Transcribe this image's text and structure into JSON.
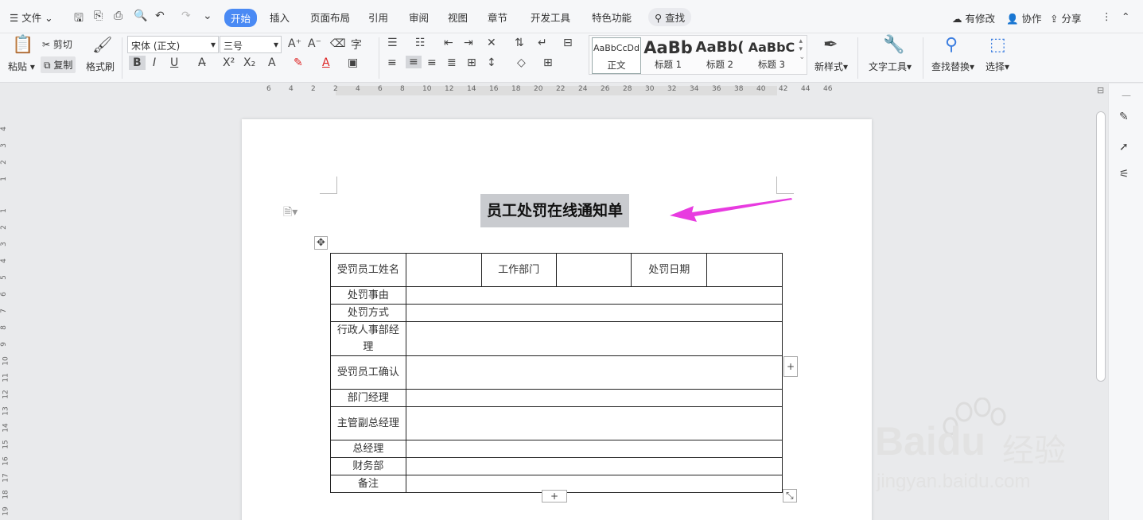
{
  "menubar": {
    "file": "文件",
    "tabs": [
      "开始",
      "插入",
      "页面布局",
      "引用",
      "审阅",
      "视图",
      "章节",
      "开发工具",
      "特色功能"
    ],
    "search": "查找",
    "modified": "有修改",
    "collab": "协作",
    "share": "分享"
  },
  "ribbon": {
    "paste": "粘贴",
    "cut": "剪切",
    "copy": "复制",
    "format_painter": "格式刷",
    "font_name": "宋体 (正文)",
    "font_size": "三号",
    "styles": [
      {
        "preview": "AaBbCcDd",
        "label": "正文"
      },
      {
        "preview": "AaBb",
        "label": "标题 1"
      },
      {
        "preview": "AaBb(",
        "label": "标题 2"
      },
      {
        "preview": "AaBbC",
        "label": "标题 3"
      }
    ],
    "new_style": "新样式",
    "text_tools": "文字工具",
    "find_replace": "查找替换",
    "select": "选择"
  },
  "ruler": {
    "h_ticks": [
      "6",
      "4",
      "2",
      "2",
      "4",
      "6",
      "8",
      "10",
      "12",
      "14",
      "16",
      "18",
      "20",
      "22",
      "24",
      "26",
      "28",
      "30",
      "32",
      "34",
      "36",
      "38",
      "40",
      "42",
      "44",
      "46"
    ],
    "v_ticks": [
      "4",
      "3",
      "2",
      "1",
      "1",
      "2",
      "3",
      "4",
      "5",
      "6",
      "7",
      "8",
      "9",
      "10",
      "11",
      "12",
      "13",
      "14",
      "15",
      "16",
      "17",
      "18",
      "19"
    ]
  },
  "document": {
    "title": "员工处罚在线通知单",
    "table": {
      "header": [
        "受罚员工姓名",
        "",
        "工作部门",
        "",
        "处罚日期",
        ""
      ],
      "rows": [
        "处罚事由",
        "处罚方式",
        "行政人事部经理",
        "受罚员工确认",
        "部门经理",
        "主管副总经理",
        "总经理",
        "财务部",
        "备注"
      ]
    }
  },
  "watermark": {
    "brand": "Bai",
    "brand2": "du",
    "cn": "经验",
    "url": "jingyan.baidu.com"
  },
  "colors": {
    "accent": "#4a8af4",
    "arrow": "#e83be0",
    "title_highlight": "#c9cbcf"
  }
}
